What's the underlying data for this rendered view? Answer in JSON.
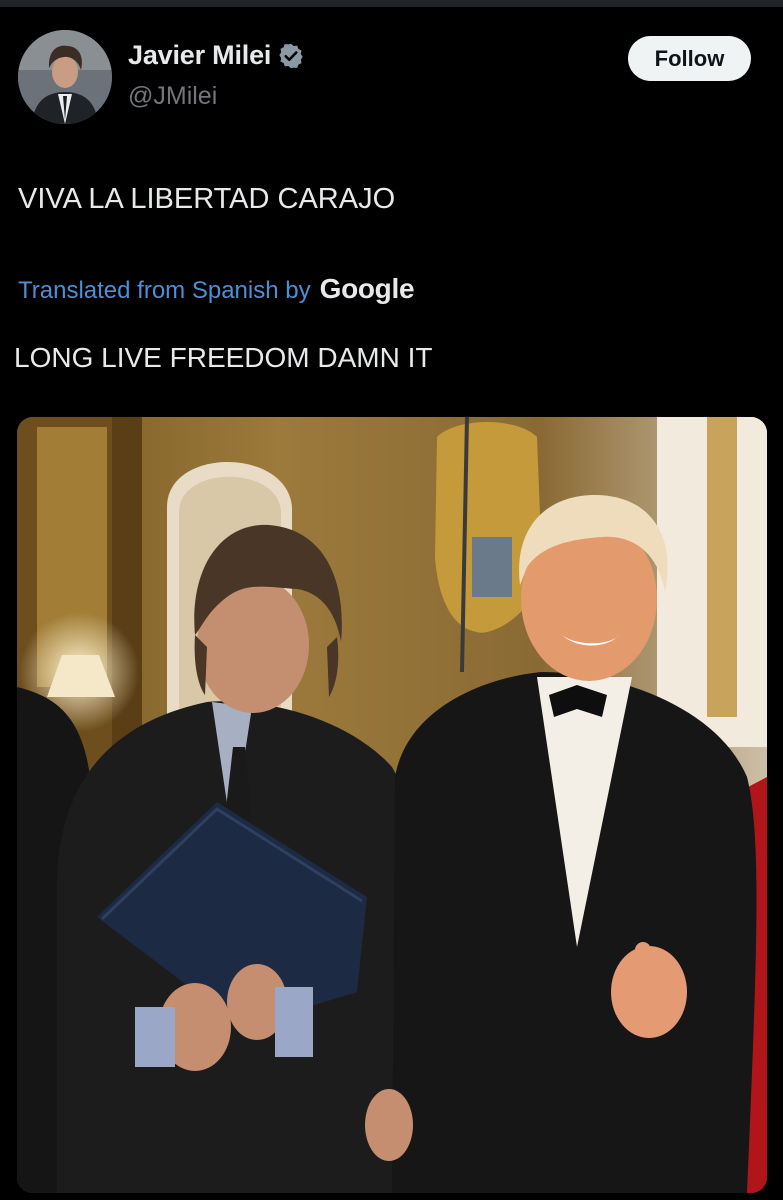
{
  "header": {
    "display_name": "Javier Milei",
    "handle": "@JMilei",
    "follow_label": "Follow"
  },
  "tweet": {
    "text": "VIVA LA LIBERTAD CARAJO",
    "translation_label": "Translated from Spanish by",
    "translation_provider": "Google",
    "translated_text": "LONG LIVE FREEDOM DAMN IT"
  },
  "colors": {
    "background": "#000000",
    "link": "#4d8fd3",
    "verified_badge": "#8b98a5",
    "follow_button_bg": "#eff3f4"
  },
  "icons": {
    "verified": "verified-badge-icon"
  }
}
